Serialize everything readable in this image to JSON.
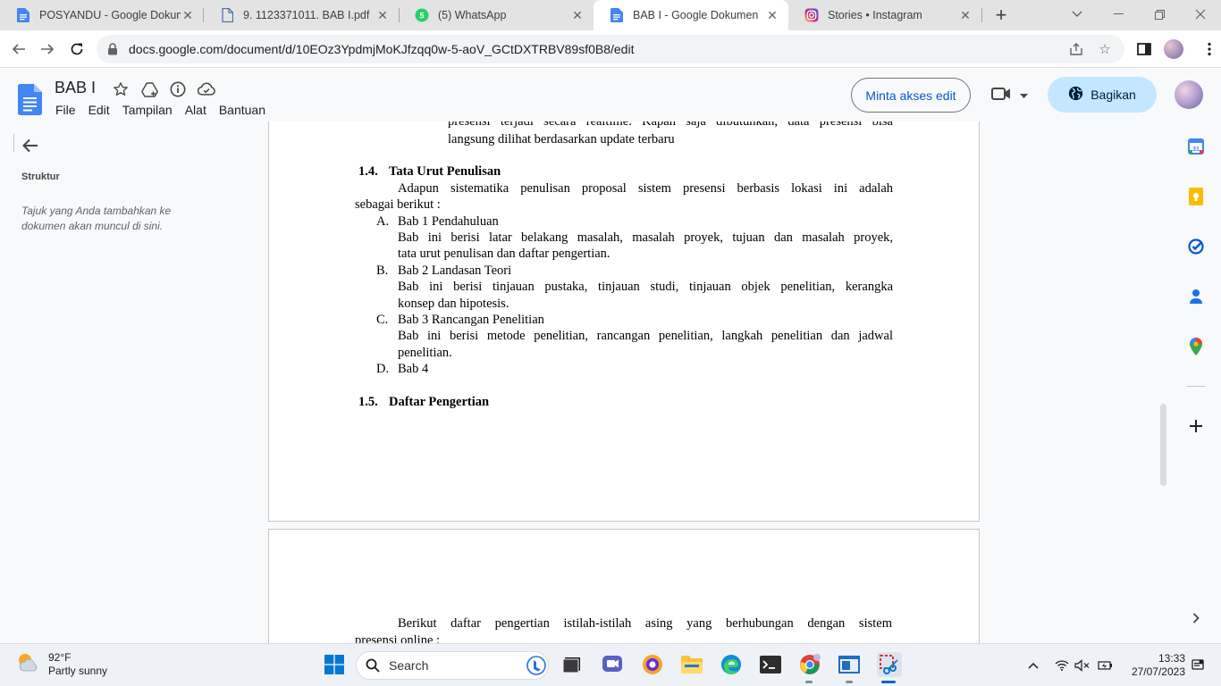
{
  "browser": {
    "tabs": [
      {
        "title": "POSYANDU - Google Dokum",
        "icon": "google-docs-icon",
        "active": false
      },
      {
        "title": "9. 1123371011. BAB I.pdf",
        "icon": "pdf-file-icon",
        "active": false
      },
      {
        "title": "(5) WhatsApp",
        "icon": "whatsapp-icon",
        "active": false
      },
      {
        "title": "BAB I - Google Dokumen",
        "icon": "google-docs-icon",
        "active": true
      },
      {
        "title": "Stories • Instagram",
        "icon": "instagram-icon",
        "active": false
      }
    ],
    "url": "docs.google.com/document/d/10EOz3YpdmjMoKJfzqq0w-5-aoV_GCtDXTRBV89sf0B8/edit"
  },
  "docs": {
    "title": "BAB I",
    "menu": [
      "File",
      "Edit",
      "Tampilan",
      "Alat",
      "Bantuan"
    ],
    "request_edit_label": "Minta akses edit",
    "share_label": "Bagikan"
  },
  "outline": {
    "label": "Struktur",
    "hint": "Tajuk yang Anda tambahkan ke dokumen akan muncul di sini."
  },
  "document": {
    "top_line_1": "presensi  terjadi  secara  realtime.  Kapan  saja  dibutuhkan,  data  presensi  bisa",
    "top_line_2": "langsung dilihat berdasarkan update terbaru",
    "h14_num": "1.4.",
    "h14_title": "Tata Urut Penulisan",
    "intro_1": "Adapun sistematika penulisan proposal sistem presensi berbasis lokasi ini adalah",
    "intro_2": "sebagai berikut :",
    "items": [
      {
        "letter": "A.",
        "title": "Bab 1 Pendahuluan",
        "desc1": "Bab ini berisi latar belakang masalah, masalah proyek, tujuan dan masalah proyek,",
        "desc2": "tata urut penulisan dan daftar pengertian."
      },
      {
        "letter": "B.",
        "title": "Bab 2 Landasan Teori",
        "desc1": "Bab ini berisi tinjauan pustaka, tinjauan studi, tinjauan objek penelitian, kerangka",
        "desc2": "konsep dan hipotesis."
      },
      {
        "letter": "C.",
        "title": "Bab 3 Rancangan Penelitian",
        "desc1": "Bab ini berisi metode penelitian, rancangan penelitian, langkah penelitian dan jadwal",
        "desc2": "penelitian."
      },
      {
        "letter": "D.",
        "title": "Bab 4"
      }
    ],
    "h15_num": "1.5.",
    "h15_title": "Daftar Pengertian",
    "page2_line_1": "Berikut daftar pengertian istilah-istilah asing yang berhubungan dengan sistem",
    "page2_line_2": "presensi online :"
  },
  "taskbar": {
    "temperature": "92°F",
    "weather": "Partly sunny",
    "search_label": "Search",
    "time": "13:33",
    "date": "27/07/2023"
  },
  "colors": {
    "accent_blue": "#0b57d0",
    "share_bg": "#c2e7ff",
    "docs_blue": "#4285f4"
  }
}
